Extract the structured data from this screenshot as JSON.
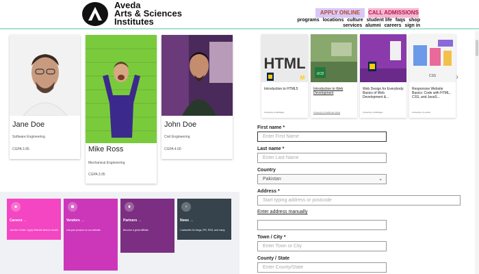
{
  "header": {
    "brand_line1": "Aveda",
    "brand_line2": "Arts & Sciences",
    "brand_line3": "Institutes",
    "apply_label": "APPLY ONLINE",
    "call_label": "CALL ADMISSIONS",
    "nav_row1": [
      "programs",
      "locations",
      "culture",
      "student life",
      "faqs",
      "shop"
    ],
    "nav_row2": [
      "services",
      "alumni",
      "careers",
      "sign in"
    ]
  },
  "profiles": [
    {
      "name": "Jane Doe",
      "dept": "Software Engineering",
      "gpa": "CGPA 3.95"
    },
    {
      "name": "Mike Ross",
      "dept": "Mechanical Engineering",
      "gpa": "CGPA 3.95"
    },
    {
      "name": "John Doe",
      "dept": "Civil Engineering",
      "gpa": "CGPA 4.00"
    }
  ],
  "tiles": [
    {
      "title": "Careers →",
      "desc": "Join the Centre. Apply Website team in Austin.",
      "color": "#f446c2"
    },
    {
      "title": "Vendors →",
      "desc": "List your product on our website.",
      "color": "#cc37b9"
    },
    {
      "title": "Partners →",
      "desc": "Become a great affiliate.",
      "color": "#7c2f82"
    },
    {
      "title": "News →",
      "desc": "I subscribe for blogs, RFI, RSS, and many.",
      "color": "#36434d"
    }
  ],
  "courses": [
    {
      "title": "Introduction to HTML5",
      "uni": "University of Michigan"
    },
    {
      "title": "Introduction to Web Development",
      "uni": "University of California, Davis"
    },
    {
      "title": "Web Design for Everybody: Basics of Web Development &...",
      "uni": "University of Michigan"
    },
    {
      "title": "Responsive Website Basics: Code with HTML, CSS, and JavaS...",
      "uni": "University of London"
    }
  ],
  "form": {
    "first_name_label": "First name *",
    "first_name_placeholder": "Enter First Name",
    "last_name_label": "Last name *",
    "last_name_placeholder": "Enter Last Name",
    "country_label": "Country",
    "country_value": "Pakistan",
    "address_label": "Address *",
    "address_placeholder": "Start typing address or postcode",
    "manual_link": "Enter address manually",
    "town_label": "Town / City *",
    "town_placeholder": "Enter Town or City",
    "county_label": "County / State",
    "county_placeholder": "Enter County/State"
  },
  "icons": {
    "logo": "aveda-arrow-logo",
    "carousel_next": "chevron-right-icon",
    "select": "chevron-down-icon"
  }
}
